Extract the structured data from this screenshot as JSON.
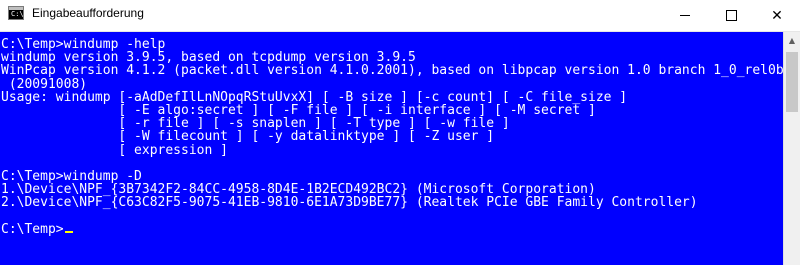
{
  "window": {
    "title": "Eingabeaufforderung",
    "icon": "cmd-icon",
    "icon_glyph": "C:\\"
  },
  "controls": {
    "minimize": "minimize-icon",
    "maximize": "maximize-icon",
    "close": "close-icon",
    "close_glyph": "✕"
  },
  "colors": {
    "console_background": "#0000ff",
    "console_text": "#ffffff",
    "cursor": "#ffff00"
  },
  "console": {
    "lines": [
      "C:\\Temp>windump -help",
      "windump version 3.9.5, based on tcpdump version 3.9.5",
      "WinPcap version 4.1.2 (packet.dll version 4.1.0.2001), based on libpcap version 1.0 branch 1_0_rel0b",
      " (20091008)",
      "Usage: windump [-aAdDefIlLnNOpqRStuUvxX] [ -B size ] [-c count] [ -C file_size ]",
      "               [ -E algo:secret ] [ -F file ] [ -i interface ] [ -M secret ]",
      "               [ -r file ] [ -s snaplen ] [ -T type ] [ -w file ]",
      "               [ -W filecount ] [ -y datalinktype ] [ -Z user ]",
      "               [ expression ]",
      "",
      "C:\\Temp>windump -D",
      "1.\\Device\\NPF_{3B7342F2-84CC-4958-8D4E-1B2ECD492BC2} (Microsoft Corporation)",
      "2.\\Device\\NPF_{C63C82F5-9075-41EB-9810-6E1A73D9BE77} (Realtek PCIe GBE Family Controller)",
      "",
      "C:\\Temp>"
    ]
  }
}
